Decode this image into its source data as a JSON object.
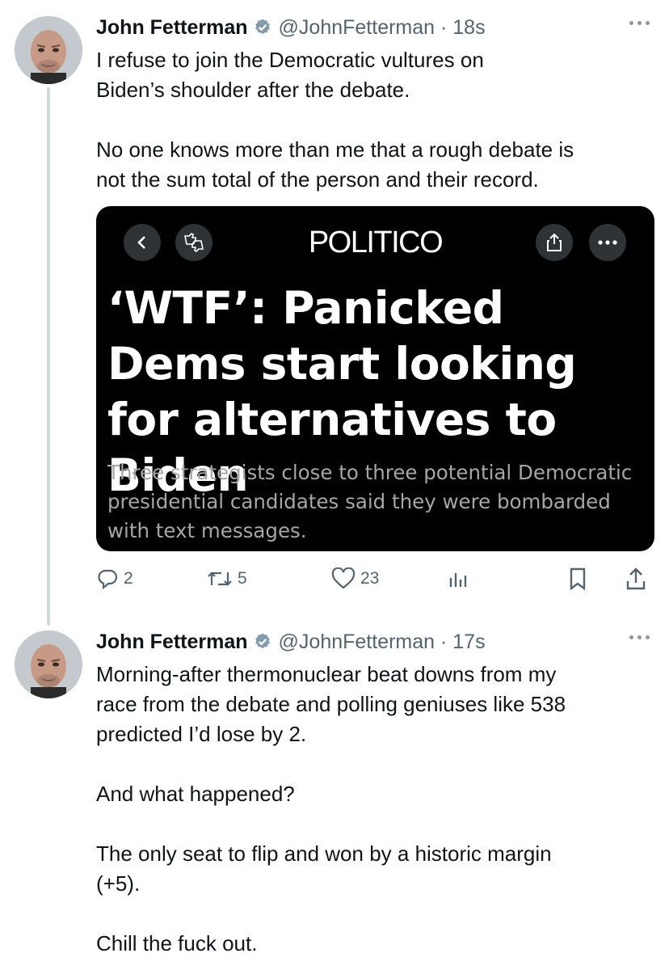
{
  "tweets": [
    {
      "author_name": "John Fetterman",
      "handle_time": "@JohnFetterman · 18s",
      "text": "I refuse to join the Democratic vultures on\nBiden’s shoulder after the debate.\n\nNo one knows more than me that a rough debate is\nnot the sum total of the person and their record.",
      "card": {
        "publisher": "POLITICO",
        "headline": "‘WTF’: Panicked Dems start looking for alternatives to Biden",
        "dek": "Three strategists close to three potential Democratic presidential candidates said they were bombarded with text messages."
      },
      "actions": {
        "replies": "2",
        "reposts": "5",
        "likes": "23"
      }
    },
    {
      "author_name": "John Fetterman",
      "handle_time": "@JohnFetterman · 17s",
      "text": "Morning-after thermonuclear beat downs from my\nrace from the debate and polling geniuses like 538\npredicted I’d lose by 2.\n\nAnd what happened?\n\nThe only seat to flip and won by a historic margin\n(+5).\n\nChill the fuck out."
    }
  ],
  "icons": {
    "verified": "verified-badge-icon",
    "more": "more-dots-icon",
    "reply": "reply-icon",
    "repost": "repost-icon",
    "like": "heart-icon",
    "views": "analytics-icon",
    "bookmark": "bookmark-icon",
    "share": "share-icon",
    "card_back": "chevron-left-icon",
    "card_dislike": "thumbs-icon",
    "card_share": "share-icon",
    "card_more": "more-dots-icon"
  },
  "colors": {
    "text": "#0f1419",
    "secondary": "#536471",
    "thread_line": "#cfd9de",
    "card_bg": "#000000",
    "dek": "#a6a6a6"
  }
}
